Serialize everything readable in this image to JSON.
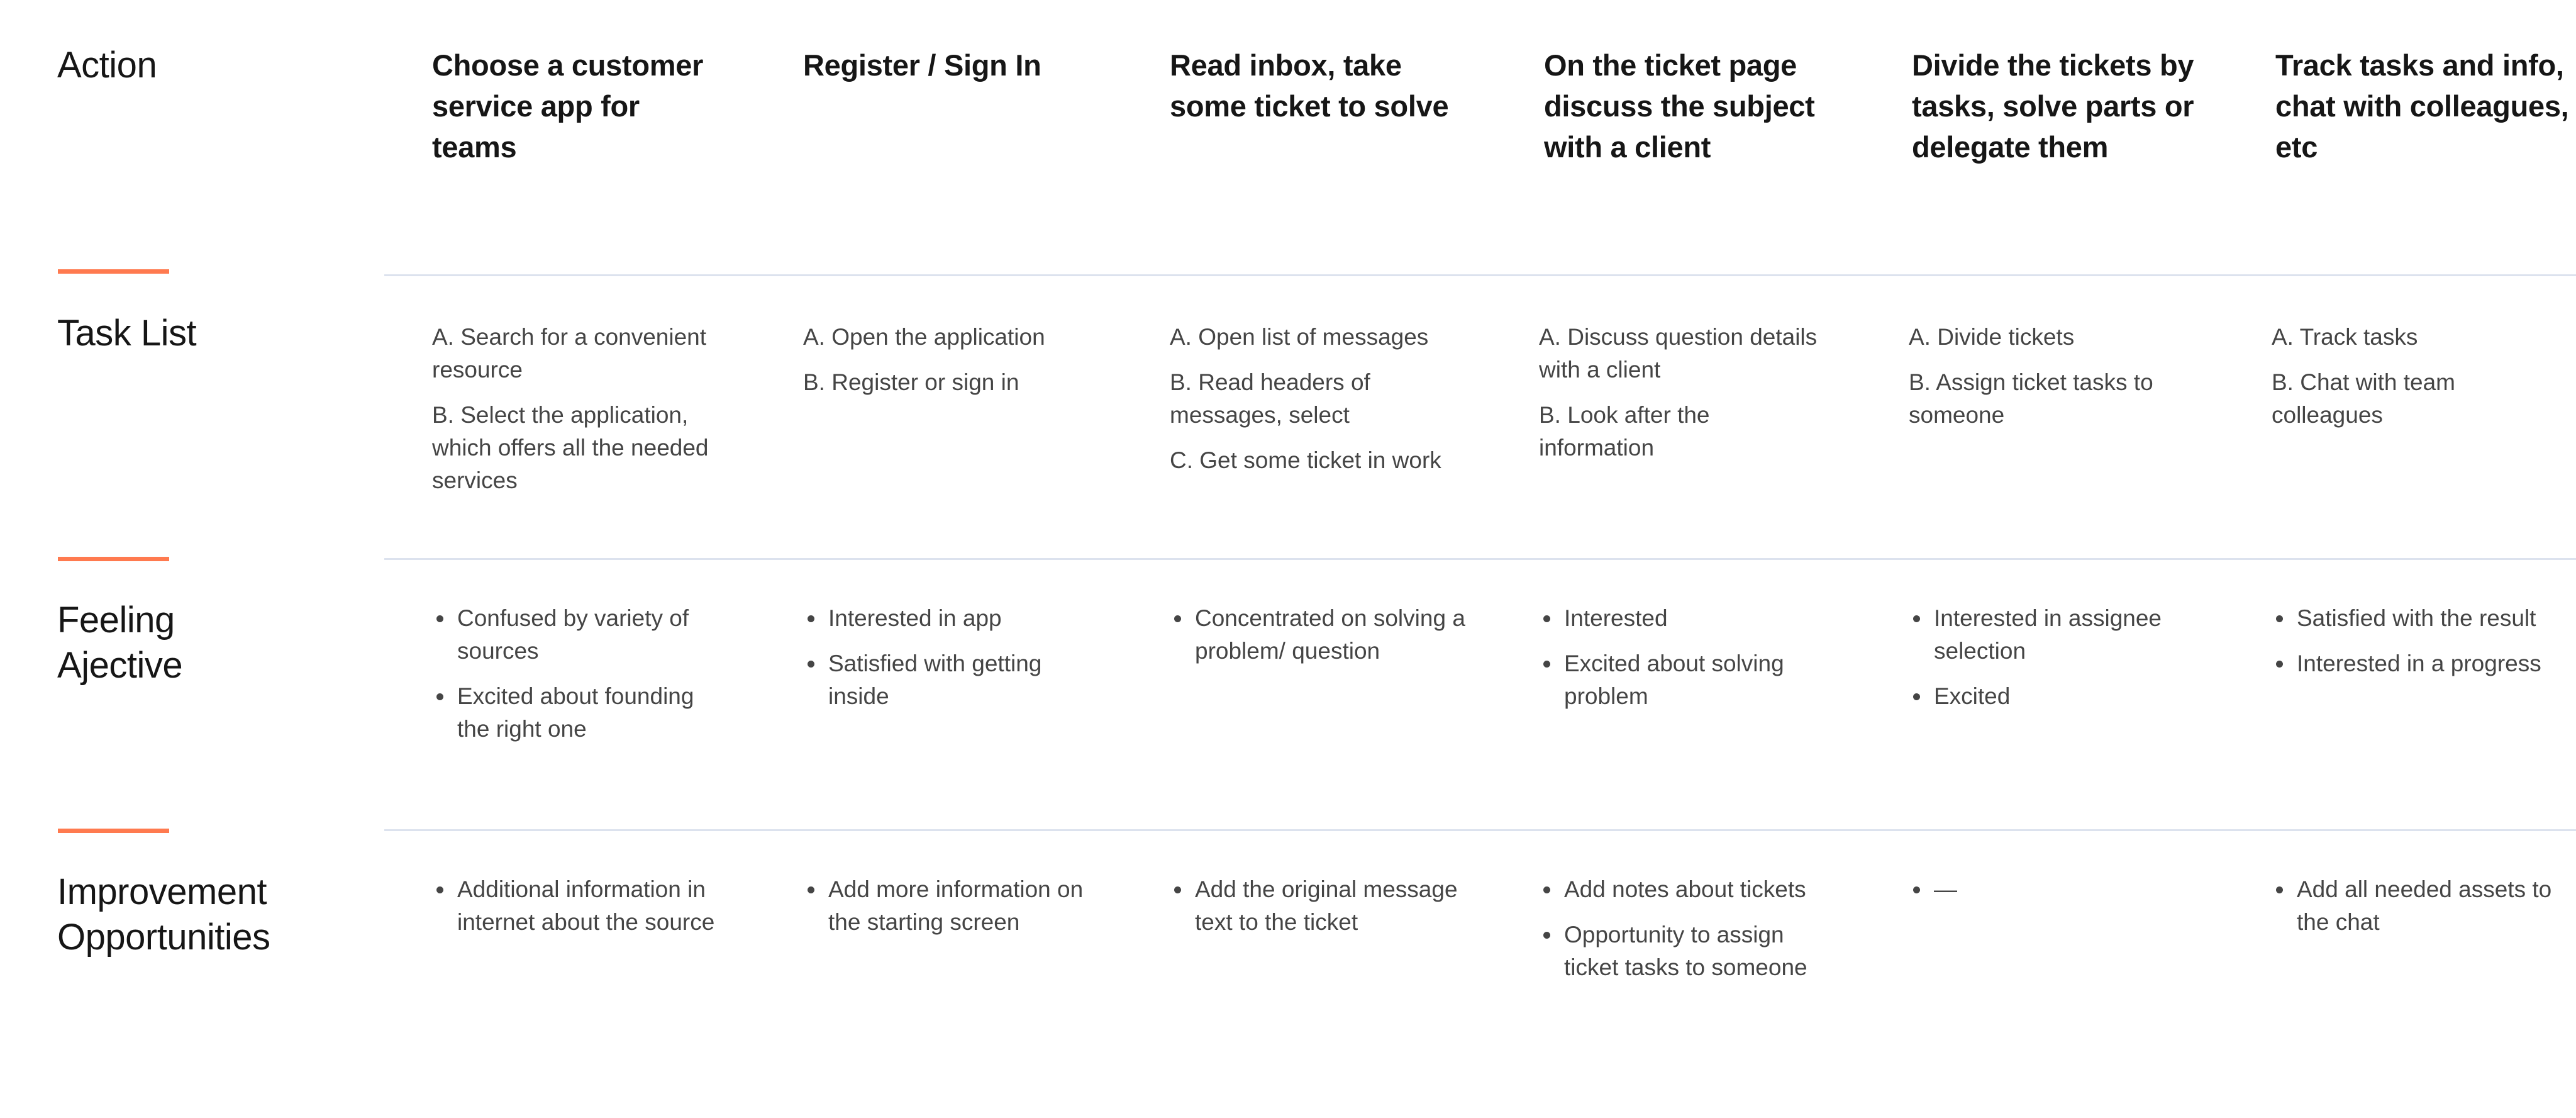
{
  "colors": {
    "accent": "#FF7A4F",
    "divider": "#DCE2EE",
    "heading_text": "#161616",
    "body_text": "#454545",
    "background": "#FFFFFF"
  },
  "rows": {
    "action": {
      "label": "Action"
    },
    "task_list": {
      "label": "Task List"
    },
    "feeling": {
      "label_line1": "Feeling",
      "label_line2": "Ajective"
    },
    "improvement": {
      "label_line1": "Improvement",
      "label_line2": "Opportunities"
    }
  },
  "stages": [
    {
      "action": "Choose a customer service app for teams",
      "tasks": [
        "A. Search for a convenient resource",
        "B. Select the application, which offers all the needed services"
      ],
      "feelings": [
        "Confused by variety of sources",
        "Excited about founding the right one"
      ],
      "improvements": [
        "Additional information in internet about the source"
      ]
    },
    {
      "action": "Register / Sign In",
      "tasks": [
        "A. Open the application",
        "B. Register or sign in"
      ],
      "feelings": [
        "Interested in app",
        "Satisfied with getting inside"
      ],
      "improvements": [
        "Add more information on the starting screen"
      ]
    },
    {
      "action": "Read inbox, take some ticket to solve",
      "tasks": [
        "A. Open list of messages",
        "B. Read headers of messages, select",
        "C. Get some ticket in work"
      ],
      "feelings": [
        "Concentrated on solving a problem/ question"
      ],
      "improvements": [
        "Add the original message text to the ticket"
      ]
    },
    {
      "action": "On the ticket page discuss the subject with a client",
      "tasks": [
        "A. Discuss question details with a client",
        "B. Look after the information"
      ],
      "feelings": [
        "Interested",
        "Excited about solving problem"
      ],
      "improvements": [
        "Add notes about tickets",
        "Opportunity to assign ticket tasks to someone"
      ]
    },
    {
      "action": "Divide the tickets by tasks, solve parts or delegate them",
      "tasks": [
        "A. Divide tickets",
        "B. Assign ticket tasks to someone"
      ],
      "feelings": [
        "Interested in assignee selection",
        "Excited"
      ],
      "improvements": [
        "—"
      ]
    },
    {
      "action": "Track tasks and info, chat with colleagues, etc",
      "tasks": [
        "A. Track tasks",
        "B. Chat with team colleagues"
      ],
      "feelings": [
        "Satisfied with the result",
        "Interested in a progress"
      ],
      "improvements": [
        "Add all needed assets to the chat"
      ]
    }
  ]
}
